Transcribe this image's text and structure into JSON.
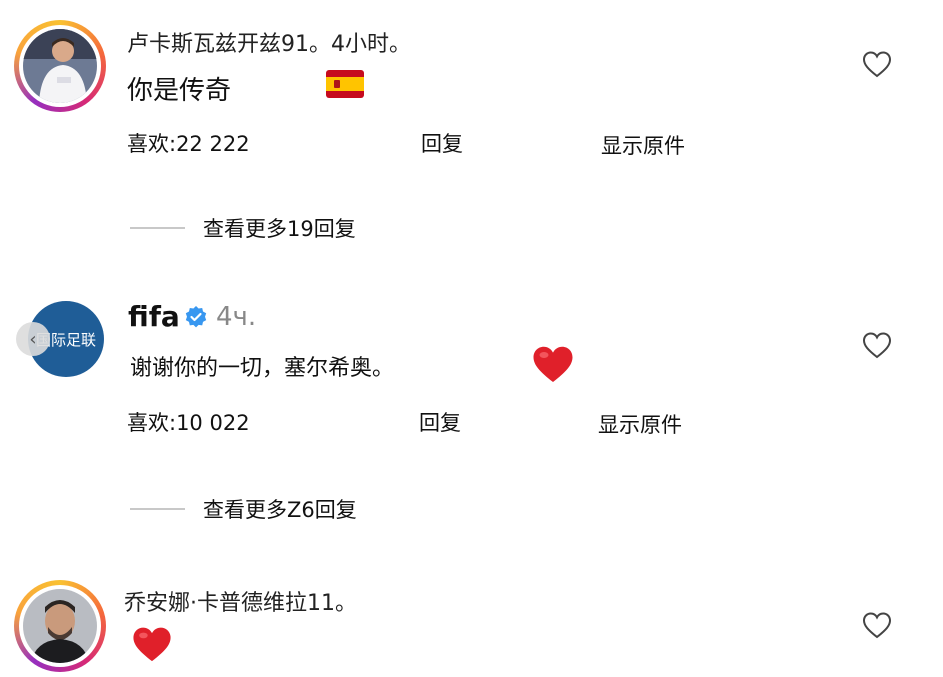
{
  "comments": [
    {
      "username": "卢卡斯瓦兹开兹91。4小时。",
      "text": "你是传奇",
      "likes_label": "喜欢:22 222",
      "reply_label": "回复",
      "original_label": "显示原件",
      "view_replies": "查看更多19回复",
      "emoji": "spain-flag-icon"
    },
    {
      "username": "fifa",
      "time": "4ч.",
      "avatar_text": "国际足联",
      "text": "谢谢你的一切，塞尔希奥。",
      "likes_label": "喜欢:10 022",
      "reply_label": "回复",
      "original_label": "显示原件",
      "view_replies": "查看更多Z6回复",
      "emoji": "red-heart-icon"
    },
    {
      "username": "乔安娜·卡普德维拉11。",
      "emoji": "red-heart-icon"
    }
  ],
  "colors": {
    "fifa_blue": "#1f5d97",
    "verified_blue": "#3897f0",
    "heart_red": "#e0202a"
  }
}
